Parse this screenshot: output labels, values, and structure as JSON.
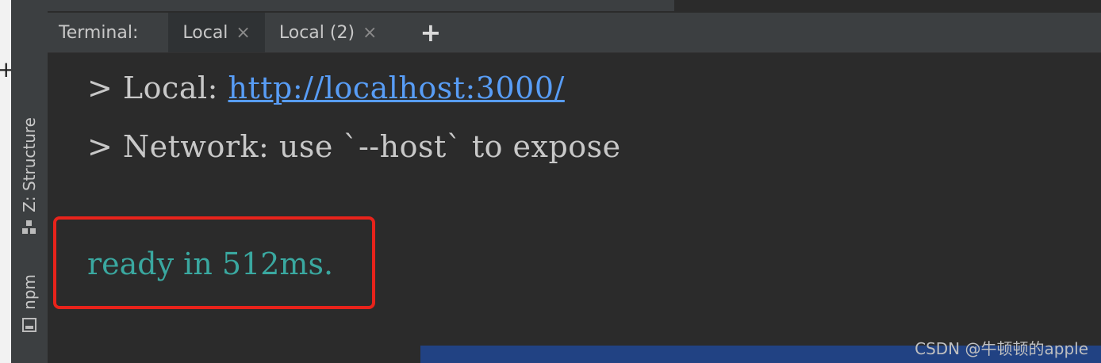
{
  "left_edge": {
    "plus": "+"
  },
  "sidebar": {
    "structure_label": "Z: Structure",
    "npm_label": "npm"
  },
  "tabbar": {
    "title": "Terminal:",
    "tabs": [
      {
        "label": "Local",
        "close": "×"
      },
      {
        "label": "Local (2)",
        "close": "×"
      }
    ],
    "add": "+"
  },
  "terminal": {
    "line1_prefix": "> Local: ",
    "line1_link": "http://localhost:3000/",
    "line2": "> Network: use `--host` to expose",
    "ready": "ready in 512ms."
  },
  "watermark": "CSDN @牛顿顿的apple",
  "colors": {
    "link": "#589df6",
    "ready": "#3aa8a0",
    "highlight": "#e8231b",
    "status_bar": "#214283"
  }
}
